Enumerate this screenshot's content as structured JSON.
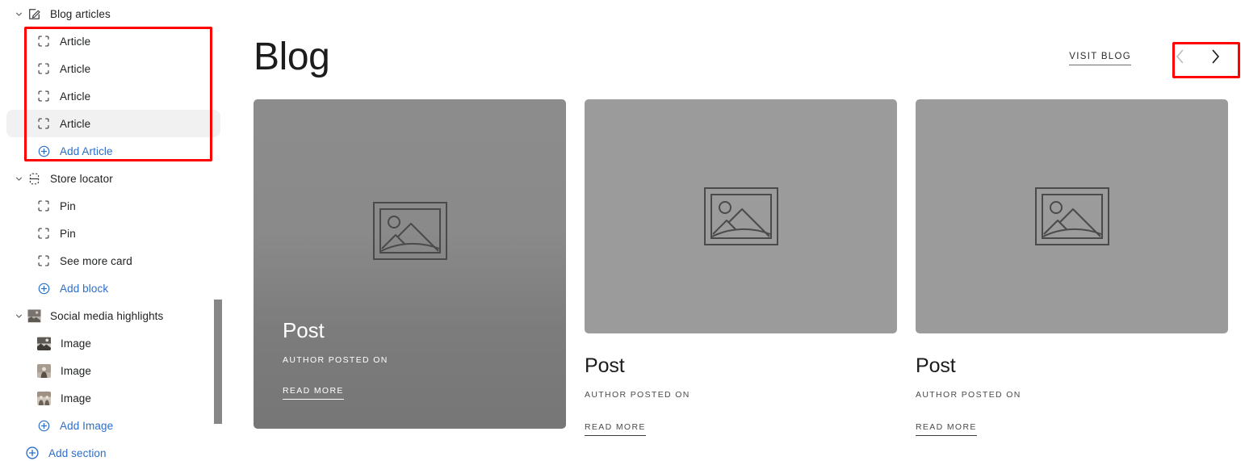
{
  "sidebar": {
    "sections": [
      {
        "name": "blog-articles",
        "label": "Blog articles",
        "icon": "blog-edit-icon",
        "expanded": true,
        "children": [
          {
            "label": "Article",
            "icon": "block-icon",
            "selected": false
          },
          {
            "label": "Article",
            "icon": "block-icon",
            "selected": false
          },
          {
            "label": "Article",
            "icon": "block-icon",
            "selected": false
          },
          {
            "label": "Article",
            "icon": "block-icon",
            "selected": true
          }
        ],
        "add_label": "Add Article"
      },
      {
        "name": "store-locator",
        "label": "Store locator",
        "icon": "store-locator-icon",
        "expanded": true,
        "children": [
          {
            "label": "Pin",
            "icon": "block-icon",
            "selected": false
          },
          {
            "label": "Pin",
            "icon": "block-icon",
            "selected": false
          },
          {
            "label": "See more card",
            "icon": "block-icon",
            "selected": false
          }
        ],
        "add_label": "Add block"
      },
      {
        "name": "social-media-highlights",
        "label": "Social media highlights",
        "icon": "photo-thumbnail-icon",
        "expanded": true,
        "children": [
          {
            "label": "Image",
            "icon": "photo-thumbnail-icon",
            "selected": false
          },
          {
            "label": "Image",
            "icon": "photo-thumbnail-icon",
            "selected": false
          },
          {
            "label": "Image",
            "icon": "photo-thumbnail-icon",
            "selected": false
          }
        ],
        "add_label": "Add Image"
      }
    ],
    "add_section_label": "Add section",
    "accent_color": "#2c6ecb"
  },
  "annotations": {
    "highlight_color": "#fe0000",
    "boxes": [
      "articles-block-list",
      "carousel-nav-buttons"
    ]
  },
  "preview": {
    "title": "Blog",
    "visit_link_label": "VISIT BLOG",
    "nav": {
      "prev_icon": "chevron-left-icon",
      "next_icon": "chevron-right-icon",
      "prev_enabled": false,
      "next_enabled": true
    },
    "cards": [
      {
        "variant": "featured",
        "title": "Post",
        "meta": "AUTHOR POSTED ON",
        "cta": "READ MORE",
        "media_icon": "image-placeholder-icon",
        "media_color": "#7f7f7f"
      },
      {
        "variant": "standard",
        "title": "Post",
        "meta": "AUTHOR POSTED ON",
        "cta": "READ MORE",
        "media_icon": "image-placeholder-icon",
        "media_color": "#9b9b9b"
      },
      {
        "variant": "standard",
        "title": "Post",
        "meta": "AUTHOR POSTED ON",
        "cta": "READ MORE",
        "media_icon": "image-placeholder-icon",
        "media_color": "#9b9b9b"
      }
    ]
  }
}
